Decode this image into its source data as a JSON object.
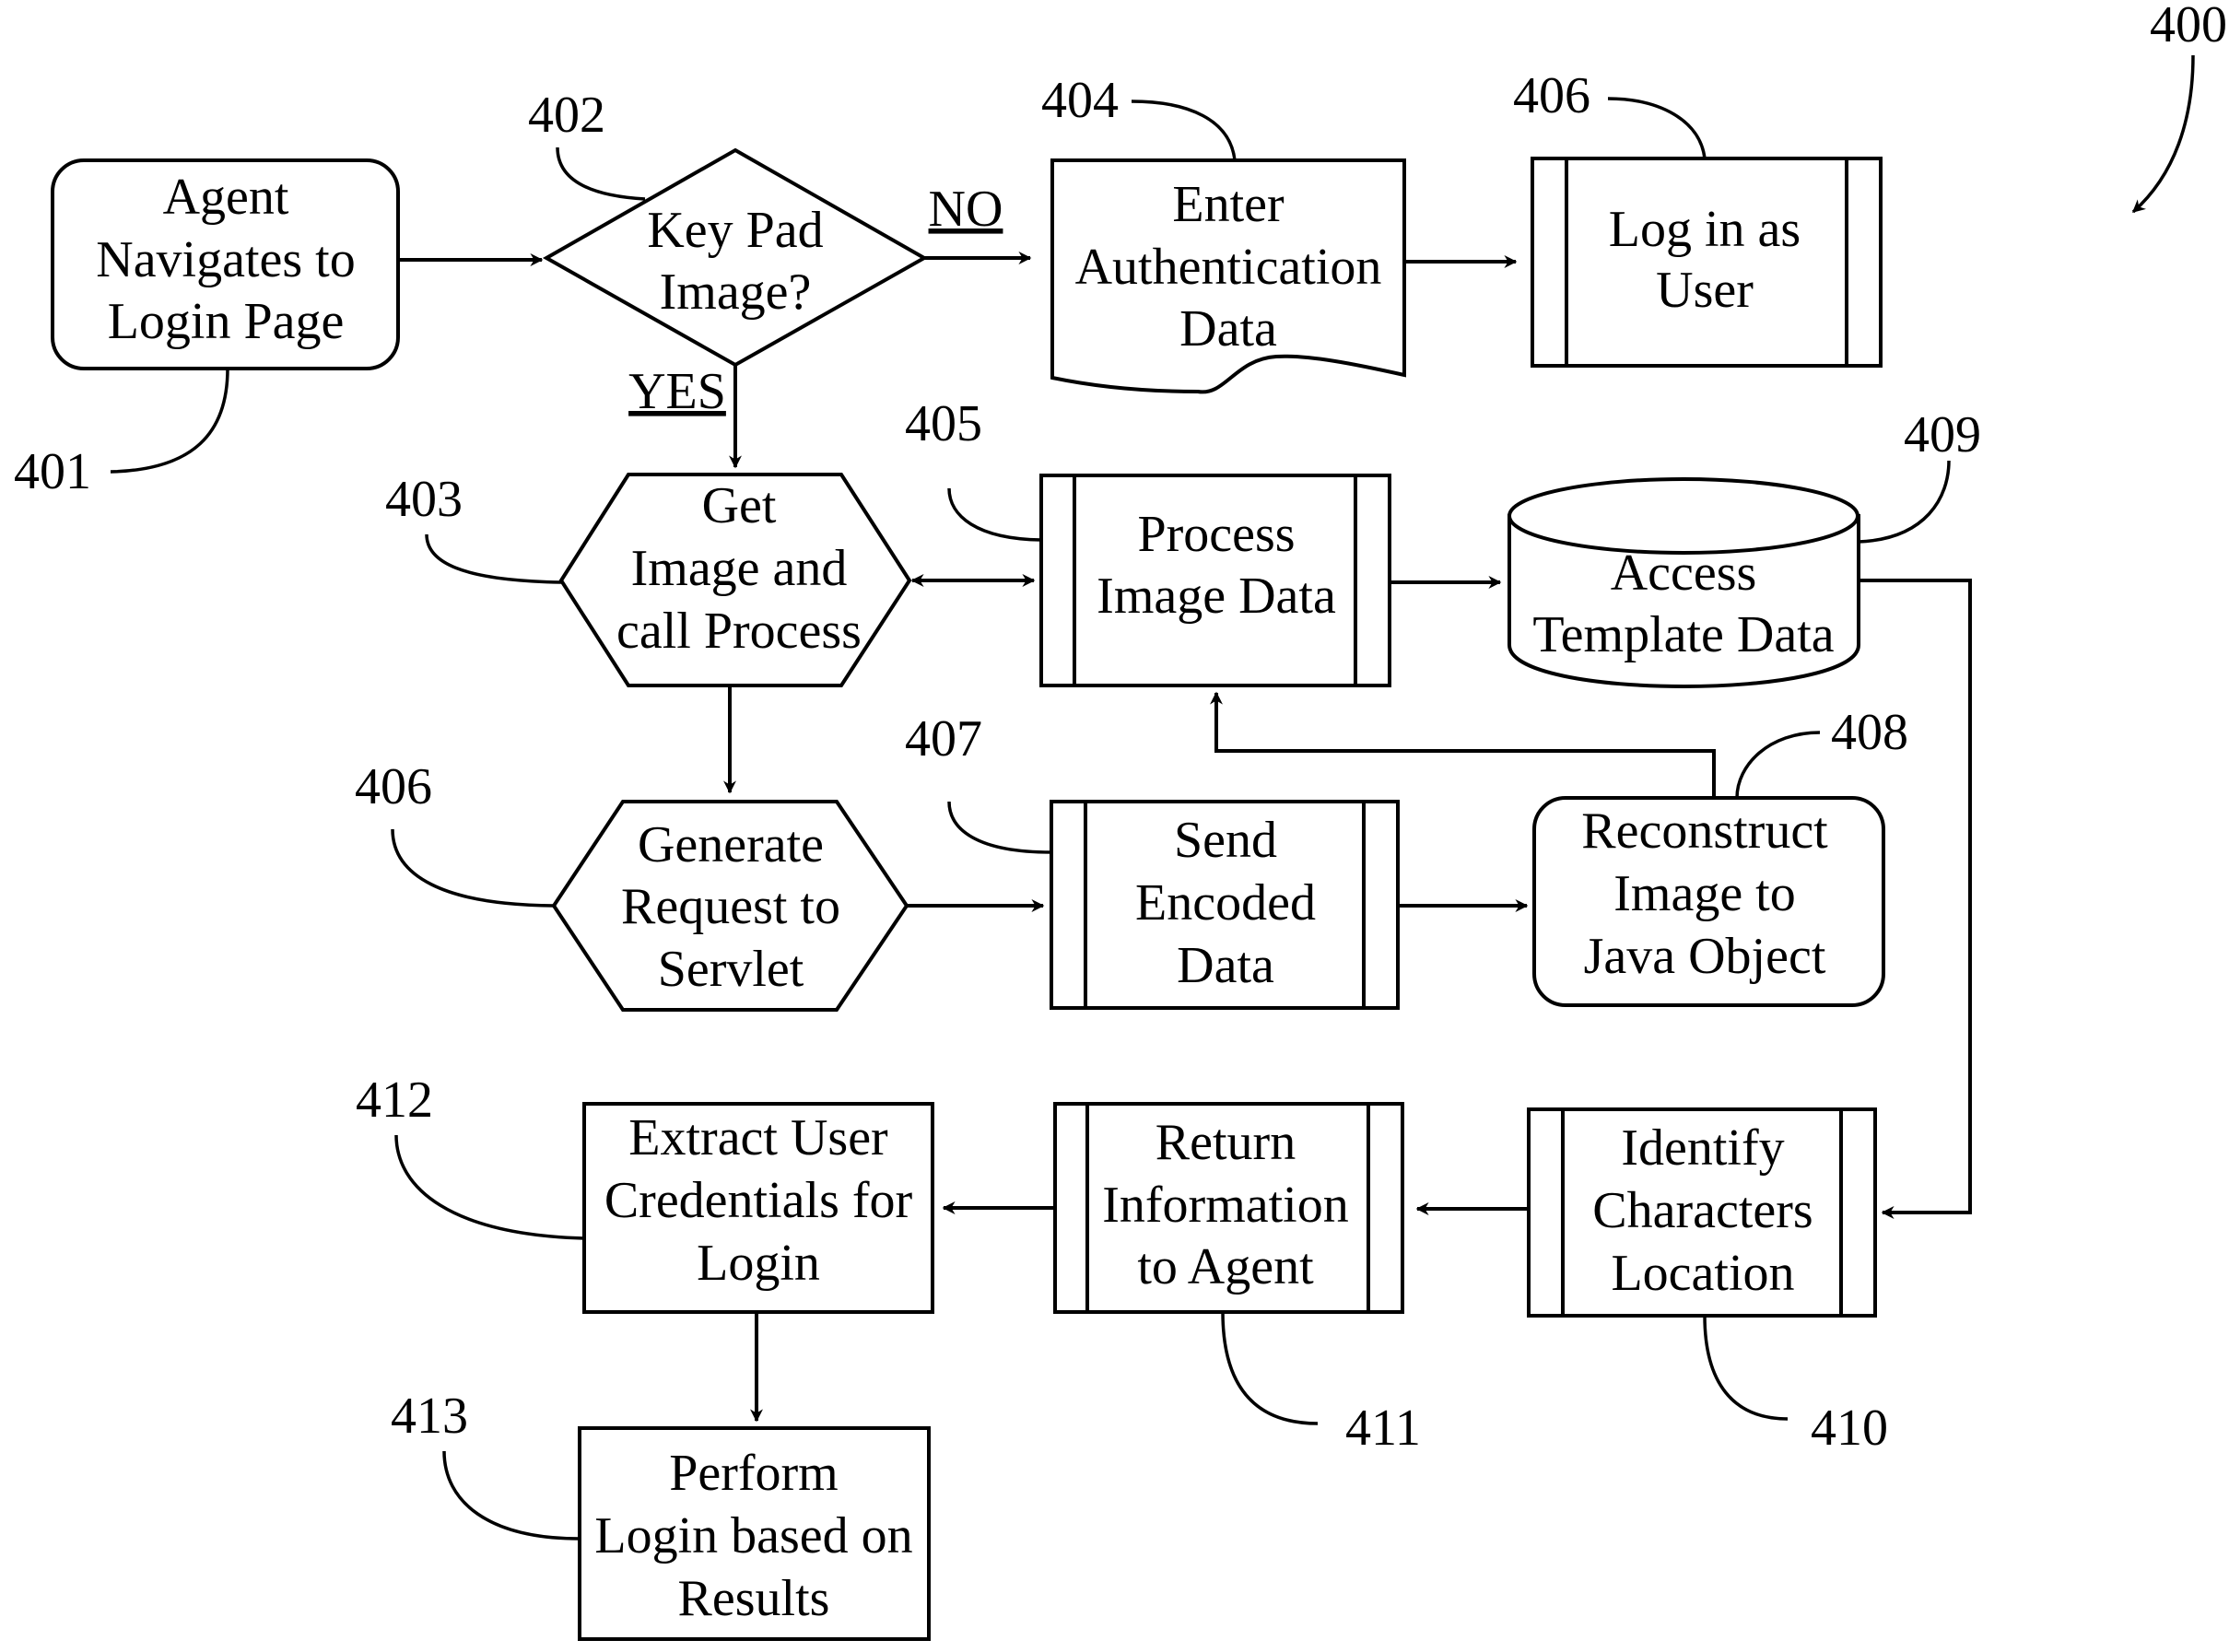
{
  "figure_ref": "400",
  "nodes": {
    "n401": {
      "ref": "401",
      "lines": [
        "Agent",
        "Navigates to",
        "Login Page"
      ],
      "shape": "rounded-rectangle"
    },
    "n402": {
      "ref": "402",
      "lines": [
        "Key Pad",
        "Image?"
      ],
      "shape": "decision-diamond"
    },
    "n404": {
      "ref": "404",
      "lines": [
        "Enter",
        "Authentication",
        "Data"
      ],
      "shape": "document"
    },
    "n406a": {
      "ref": "406",
      "lines": [
        "Log in as",
        "User"
      ],
      "shape": "predefined-process"
    },
    "n403": {
      "ref": "403",
      "lines": [
        "Get",
        "Image and",
        "call Process"
      ],
      "shape": "hexagon"
    },
    "n405": {
      "ref": "405",
      "lines": [
        "Process",
        "Image Data"
      ],
      "shape": "predefined-process"
    },
    "n409": {
      "ref": "409",
      "lines": [
        "Access",
        "Template Data"
      ],
      "shape": "database-cylinder"
    },
    "n406b": {
      "ref": "406",
      "lines": [
        "Generate",
        "Request to",
        "Servlet"
      ],
      "shape": "hexagon"
    },
    "n407": {
      "ref": "407",
      "lines": [
        "Send",
        "Encoded",
        "Data"
      ],
      "shape": "predefined-process"
    },
    "n408": {
      "ref": "408",
      "lines": [
        "Reconstruct",
        "Image to",
        "Java Object"
      ],
      "shape": "rounded-rectangle"
    },
    "n412": {
      "ref": "412",
      "lines": [
        "Extract User",
        "Credentials for",
        "Login"
      ],
      "shape": "rectangle"
    },
    "n411": {
      "ref": "411",
      "lines": [
        "Return",
        "Information",
        "to Agent"
      ],
      "shape": "predefined-process"
    },
    "n410": {
      "ref": "410",
      "lines": [
        "Identify",
        "Characters",
        "Location"
      ],
      "shape": "predefined-process"
    },
    "n413": {
      "ref": "413",
      "lines": [
        "Perform",
        "Login based on",
        "Results"
      ],
      "shape": "rectangle"
    }
  },
  "edge_labels": {
    "no": "NO",
    "yes": "YES"
  },
  "edges": [
    {
      "from": "401",
      "to": "402"
    },
    {
      "from": "402",
      "to": "404",
      "label": "NO"
    },
    {
      "from": "404",
      "to": "406 (Log in as User)"
    },
    {
      "from": "402",
      "to": "403",
      "label": "YES"
    },
    {
      "from": "403",
      "to": "405",
      "bidirectional": true
    },
    {
      "from": "405",
      "to": "409"
    },
    {
      "from": "403",
      "to": "406 (Generate Request to Servlet)"
    },
    {
      "from": "406 (Generate Request to Servlet)",
      "to": "407"
    },
    {
      "from": "407",
      "to": "408"
    },
    {
      "from": "408",
      "to": "405"
    },
    {
      "from": "409",
      "to": "410"
    },
    {
      "from": "410",
      "to": "411"
    },
    {
      "from": "411",
      "to": "412"
    },
    {
      "from": "412",
      "to": "413"
    }
  ]
}
